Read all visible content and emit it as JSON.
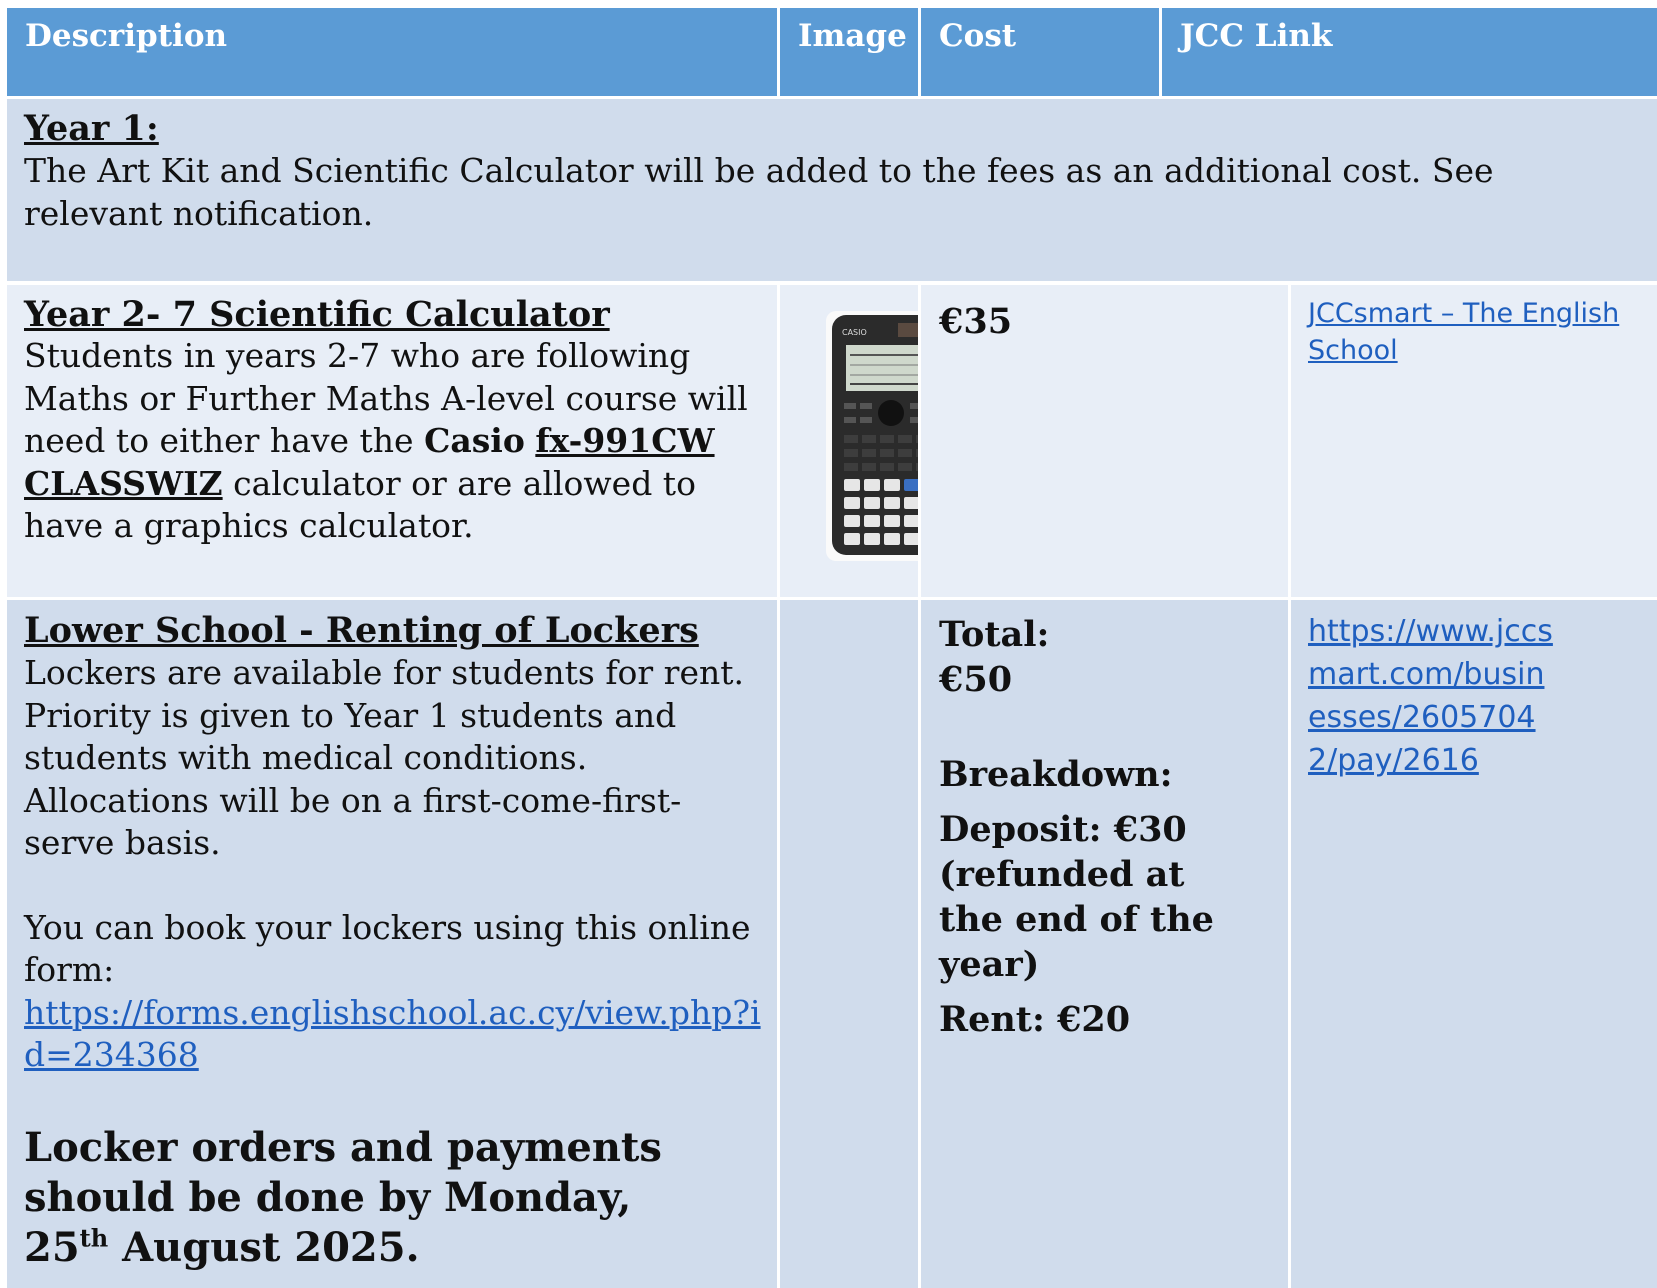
{
  "header": {
    "description": "Description",
    "image": "Image",
    "cost": "Cost",
    "jcc_link": "JCC Link"
  },
  "year1": {
    "title": "Year 1:",
    "text": "The Art Kit and Scientific Calculator will be added to the fees as an additional cost. See relevant notification."
  },
  "calculator": {
    "title": "Year 2- 7 Scientific Calculator",
    "text_before": "Students in years 2-7 who are following Maths or Further Maths A-level course will need to either have the ",
    "brand": "Casio",
    "model": "fx-991CW CLASSWIZ",
    "text_after": "  calculator or are allowed to have a graphics calculator.",
    "cost": "€35",
    "link_text": "JCCsmart – The English School",
    "image_label": "CASIO"
  },
  "lockers": {
    "title": "Lower School - Renting of Lockers",
    "text": "Lockers are available for students for rent. Priority is given to Year 1 students and students with medical conditions.  Allocations will be on a first-come-first-serve basis.",
    "book_text": "You can book your lockers using this online form:",
    "form_link": "https://forms.englishschool.ac.cy/view.php?id=234368",
    "deadline_before": "Locker orders and payments should be done by Monday, 25",
    "deadline_sup": "th",
    "deadline_after": " August 2025.",
    "total_label": "Total:",
    "total_value": "€50",
    "breakdown_label": "Breakdown:",
    "deposit": "Deposit: €30 (refunded at the end of the year)",
    "rent": "Rent: €20",
    "jcc_link": "https://www.jccsmart.com/businesses/26057042/pay/2616"
  },
  "colors": {
    "header_bg": "#5b9bd5",
    "row_dark": "#d0dcec",
    "row_light": "#e8eef7",
    "link": "#1f5fbf"
  }
}
